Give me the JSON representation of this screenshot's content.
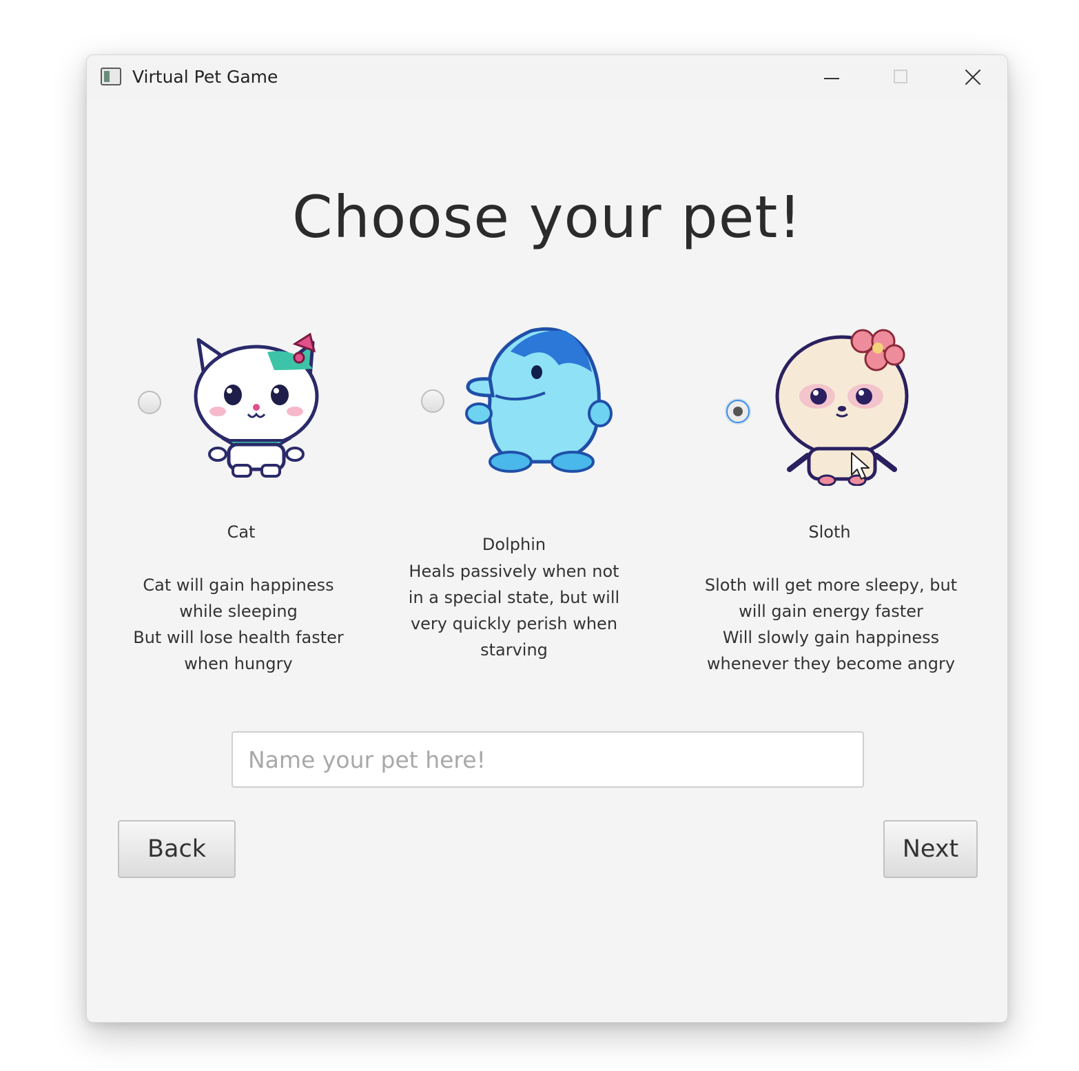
{
  "window": {
    "title": "Virtual Pet Game"
  },
  "heading": "Choose your pet!",
  "pets": [
    {
      "name": "Cat",
      "description": "Cat will gain happiness\nwhile sleeping\nBut will lose health faster\nwhen hungry",
      "selected": false,
      "image": "cat-sprite"
    },
    {
      "name": "Dolphin",
      "description": "Heals passively when not\nin a special state, but will\nvery quickly perish when\nstarving",
      "selected": false,
      "image": "dolphin-sprite"
    },
    {
      "name": "Sloth",
      "description": "Sloth will get more sleepy, but\nwill gain energy faster\nWill slowly gain happiness\nwhenever they become angry",
      "selected": true,
      "image": "sloth-sprite"
    }
  ],
  "name_input": {
    "value": "",
    "placeholder": "Name your pet here!"
  },
  "buttons": {
    "back": "Back",
    "next": "Next"
  },
  "colors": {
    "window_bg": "#f4f4f4",
    "radio_selected_ring": "#3b8fe8",
    "text": "#333333"
  }
}
